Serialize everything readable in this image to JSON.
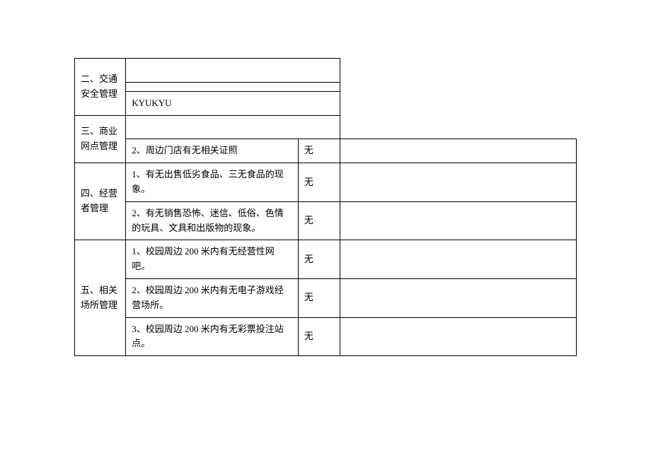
{
  "sections": {
    "s2": {
      "title": "二、交通安全管理",
      "row2_text": "",
      "row3_text": "KYUKYU"
    },
    "s3": {
      "title": "三、商业网点管理",
      "item2": "2、周边门店有无相关证照",
      "answer2": "无"
    },
    "s4": {
      "title": "四、经营者管理",
      "item1": "1、有无出售低劣食品、三无食品的现象。",
      "answer1": "无",
      "item2": "2、有无销售恐怖、迷信、低俗、色情的玩具、文具和出版物的现象。",
      "answer2": "无"
    },
    "s5": {
      "title": "五、相关场所管理",
      "item1": "1、校园周边 200 米内有无经营性网吧。",
      "answer1": "无",
      "item2": "2、校园周边 200 米内有无电子游戏经营场所。",
      "answer2": "无",
      "item3": "3、校园周边 200 米内有无彩票投注站点。",
      "answer3": "无"
    }
  }
}
